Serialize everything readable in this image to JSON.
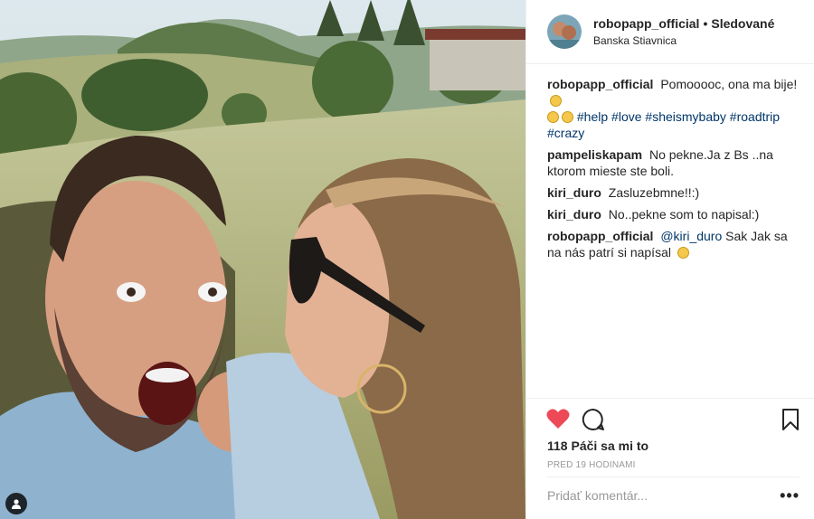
{
  "header": {
    "username": "robopapp_official",
    "separator": "•",
    "follow_status": "Sledované",
    "location": "Banska Stiavnica"
  },
  "caption": {
    "username": "robopapp_official",
    "text": "Pomooooc, ona ma bije!",
    "hashtags": [
      "#help",
      "#love",
      "#sheismybaby",
      "#roadtrip",
      "#crazy"
    ]
  },
  "comments": [
    {
      "username": "pampeliskapam",
      "text": "No pekne.Ja z Bs ..na ktorom mieste ste boli."
    },
    {
      "username": "kiri_duro",
      "text": "Zasluzebmne!!:)"
    },
    {
      "username": "kiri_duro",
      "text": "No..pekne som to napisal:)"
    },
    {
      "username": "robopapp_official",
      "mention": "@kiri_duro",
      "text": "Sak Jak sa na nás patrí si napísal"
    }
  ],
  "actions": {
    "likes": "118 Páči sa mi to",
    "time": "PRED 19 HODINAMI",
    "comment_placeholder": "Pridať komentár...",
    "more": "•••"
  },
  "icons": {
    "like": "heart-icon",
    "comment": "comment-icon",
    "save": "bookmark-icon",
    "tag": "user-tag-icon"
  },
  "colors": {
    "heart": "#ed4956",
    "link": "#003569",
    "muted": "#999999",
    "text": "#262626"
  }
}
